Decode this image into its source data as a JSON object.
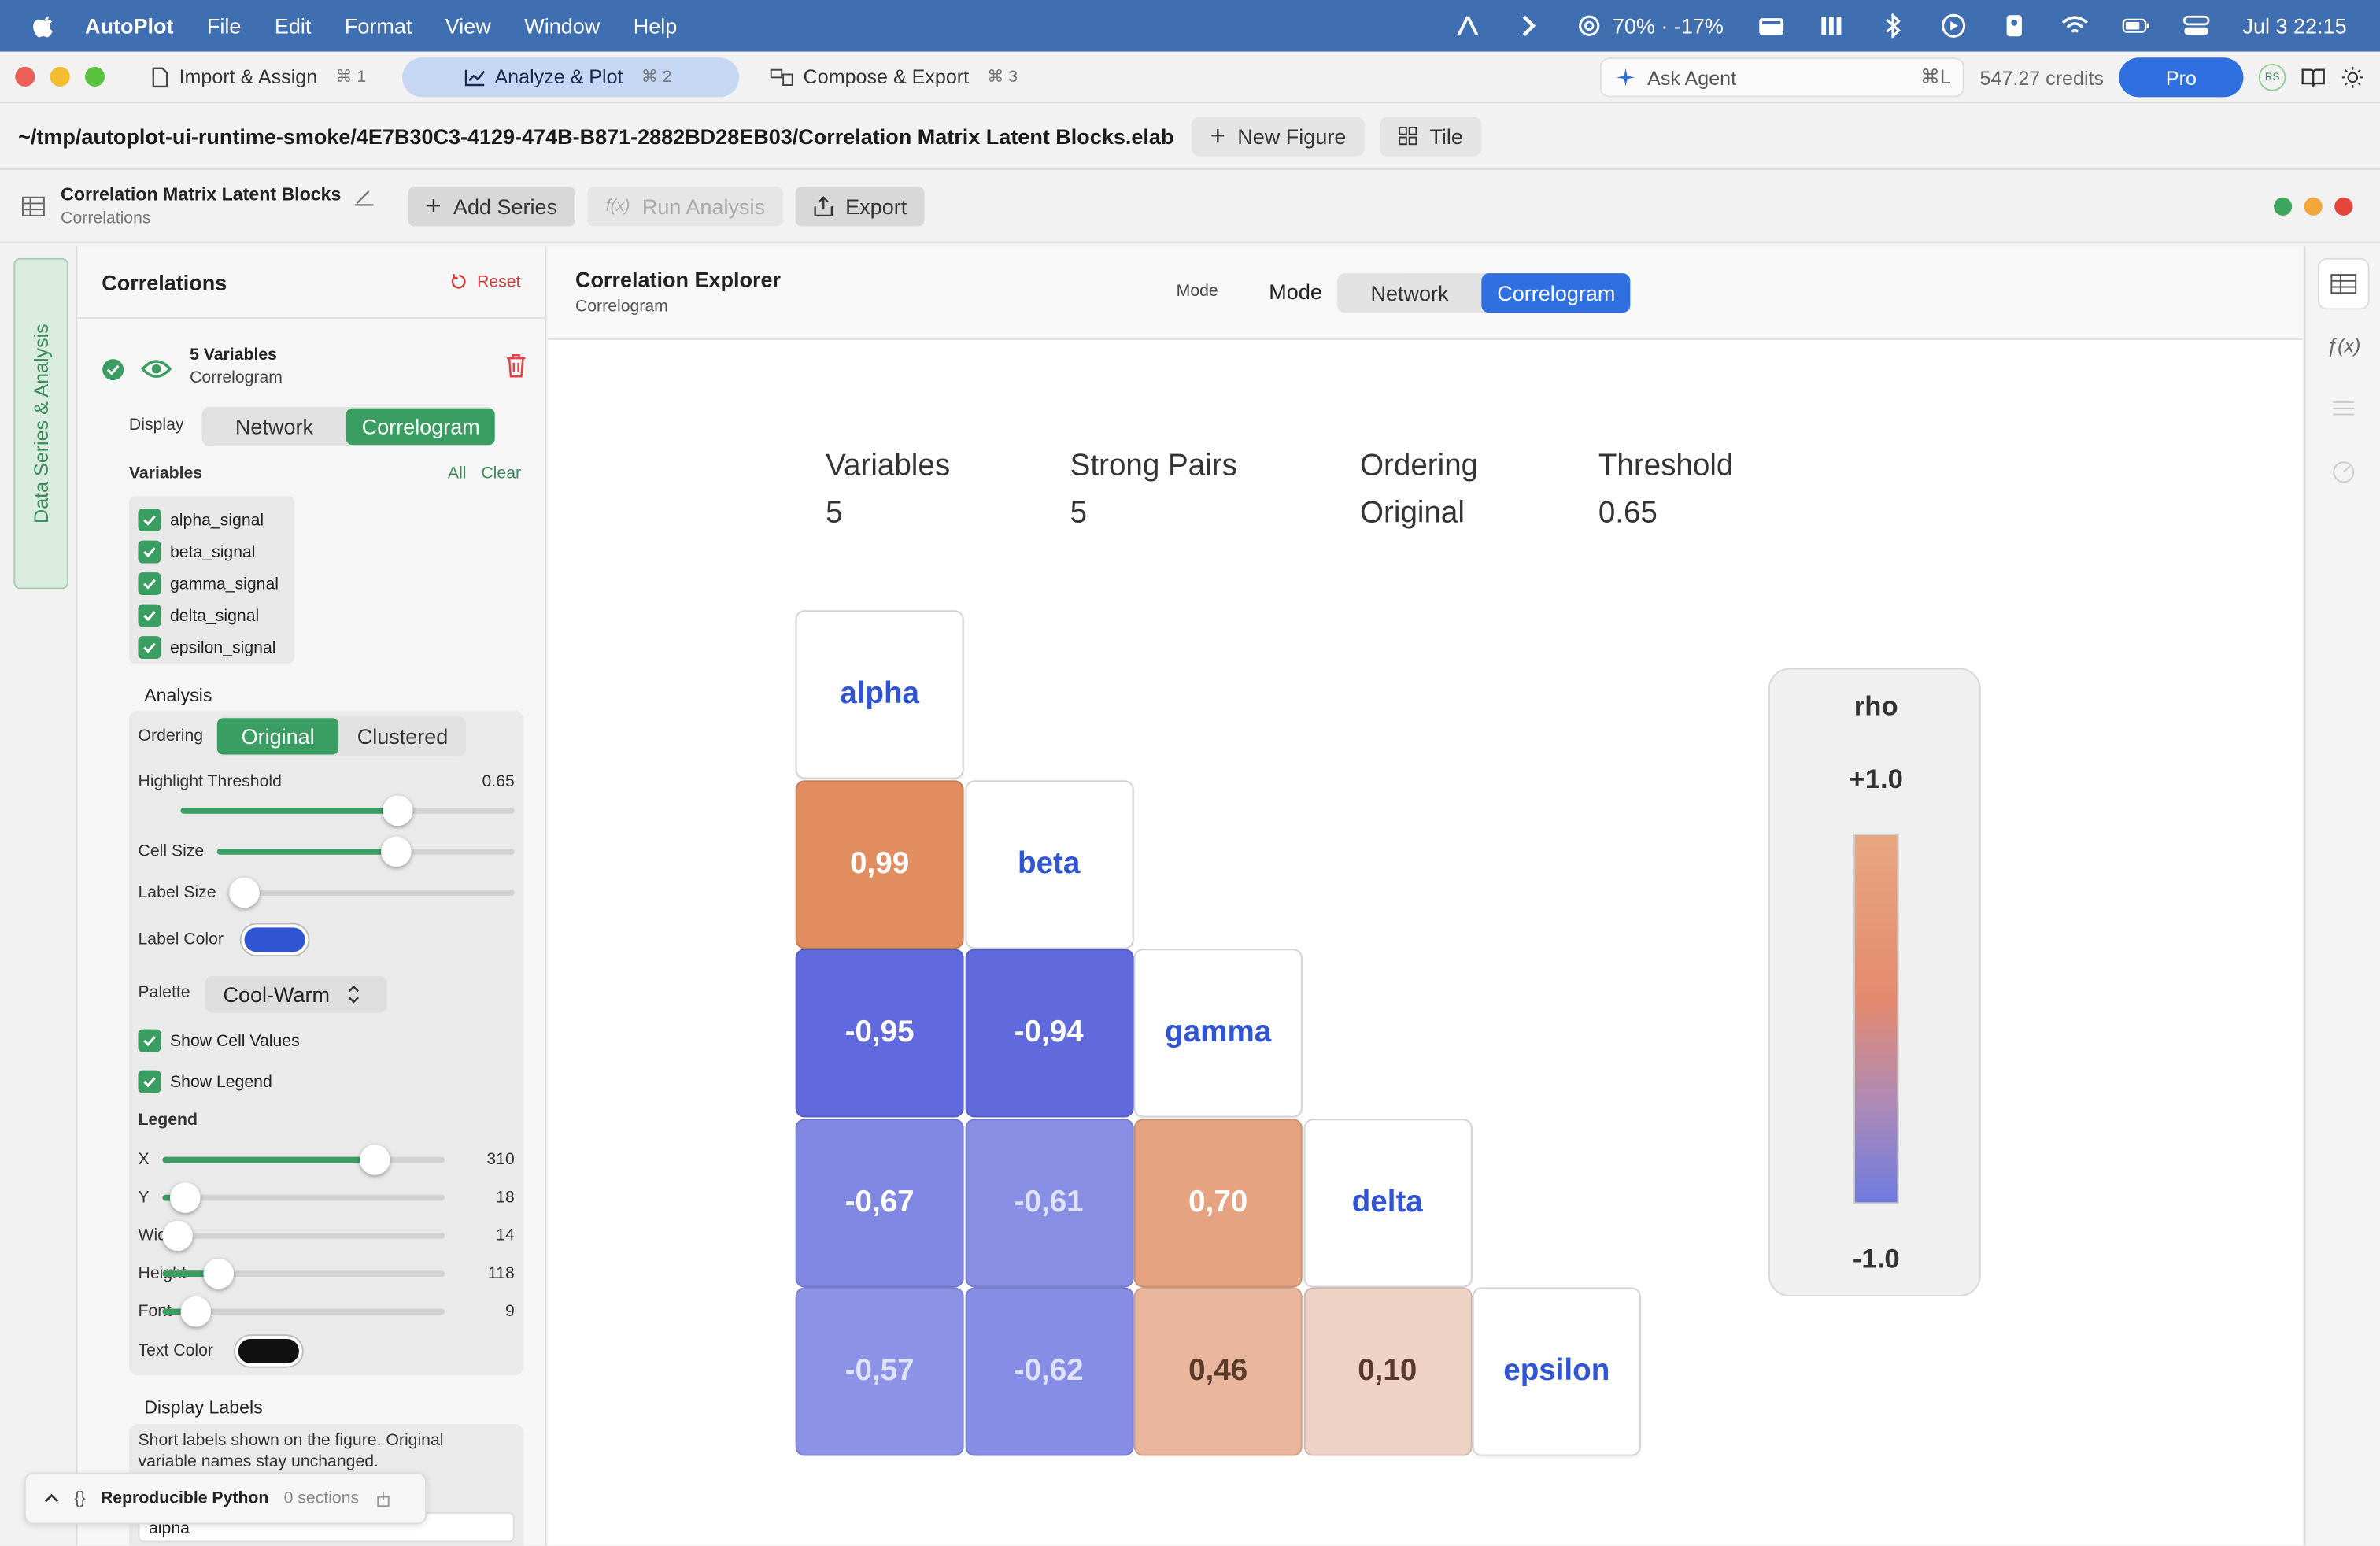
{
  "menubar": {
    "app_name": "AutoPlot",
    "menus": [
      "File",
      "Edit",
      "Format",
      "View",
      "Window",
      "Help"
    ],
    "battery_status": "70% · -17%",
    "datetime": "Jul 3  22:15"
  },
  "tabs": [
    {
      "label": "Import & Assign",
      "shortcut": "⌘ 1"
    },
    {
      "label": "Analyze & Plot",
      "shortcut": "⌘ 2"
    },
    {
      "label": "Compose & Export",
      "shortcut": "⌘ 3"
    }
  ],
  "topbar": {
    "ask_label": "Ask Agent",
    "ask_shortcut": "⌘L",
    "credits": "547.27 credits",
    "pro_label": "Pro",
    "avatar_initials": "RS"
  },
  "pathbar": {
    "path": "~/tmp/autoplot-ui-runtime-smoke/4E7B30C3-4129-474B-B871-2882BD28EB03/Correlation Matrix Latent Blocks.elab",
    "new_figure": "New Figure",
    "tile": "Tile"
  },
  "figure": {
    "title": "Correlation Matrix Latent Blocks",
    "subtitle": "Correlations",
    "add_series": "Add Series",
    "run_analysis_prefix": "f(x)",
    "run_analysis": "Run Analysis",
    "export": "Export"
  },
  "vertical_tab": "Data Series & Analysis",
  "panel": {
    "title": "Correlations",
    "reset": "Reset",
    "series_title": "5 Variables",
    "series_sub": "Correlogram",
    "display_label": "Display",
    "display_options": [
      "Network",
      "Correlogram"
    ],
    "variables_label": "Variables",
    "all": "All",
    "clear": "Clear",
    "variables": [
      "alpha_signal",
      "beta_signal",
      "gamma_signal",
      "delta_signal",
      "epsilon_signal"
    ],
    "analysis_label": "Analysis",
    "ordering_label": "Ordering",
    "ordering_options": [
      "Original",
      "Clustered"
    ],
    "highlight_label": "Highlight Threshold",
    "highlight_value": "0.65",
    "highlight_fraction": 0.65,
    "cell_size_label": "Cell Size",
    "cell_size_fraction": 0.6,
    "label_size_label": "Label Size",
    "label_size_fraction": 0.02,
    "label_color_label": "Label Color",
    "label_color": "#2f55d4",
    "palette_label": "Palette",
    "palette_value": "Cool-Warm",
    "show_values_label": "Show Cell Values",
    "show_legend_label": "Show Legend",
    "legend_label": "Legend",
    "legend_sliders": [
      {
        "label": "X",
        "value": "310",
        "fraction": 0.75
      },
      {
        "label": "Y",
        "value": "18",
        "fraction": 0.08
      },
      {
        "label": "Width",
        "value": "14",
        "fraction": 0.0
      },
      {
        "label": "Height",
        "value": "118",
        "fraction": 0.2
      },
      {
        "label": "Font",
        "value": "9",
        "fraction": 0.12
      }
    ],
    "text_color_label": "Text Color",
    "text_color": "#111111",
    "display_labels_title": "Display Labels",
    "display_labels_desc": "Short labels shown on the figure. Original variable names stay unchanged.",
    "first_label_value": "alpha"
  },
  "python_bar": {
    "label": "Reproducible Python",
    "sections": "0 sections"
  },
  "main": {
    "title": "Correlation Explorer",
    "subtitle": "Correlogram",
    "mode_small": "Mode",
    "mode_big": "Mode",
    "mode_options": [
      "Network",
      "Correlogram"
    ]
  },
  "chart_data": {
    "type": "heatmap",
    "stats": [
      {
        "label": "Variables",
        "value": "5"
      },
      {
        "label": "Strong Pairs",
        "value": "5"
      },
      {
        "label": "Ordering",
        "value": "Original"
      },
      {
        "label": "Threshold",
        "value": "0.65"
      }
    ],
    "variables": [
      "alpha",
      "beta",
      "gamma",
      "delta",
      "epsilon"
    ],
    "cells": [
      {
        "row": 1,
        "col": 0,
        "value": 0.99,
        "label": "0,99"
      },
      {
        "row": 2,
        "col": 0,
        "value": -0.95,
        "label": "-0,95"
      },
      {
        "row": 2,
        "col": 1,
        "value": -0.94,
        "label": "-0,94"
      },
      {
        "row": 3,
        "col": 0,
        "value": -0.67,
        "label": "-0,67"
      },
      {
        "row": 3,
        "col": 1,
        "value": -0.61,
        "label": "-0,61"
      },
      {
        "row": 3,
        "col": 2,
        "value": 0.7,
        "label": "0,70"
      },
      {
        "row": 4,
        "col": 0,
        "value": -0.57,
        "label": "-0,57"
      },
      {
        "row": 4,
        "col": 1,
        "value": -0.62,
        "label": "-0,62"
      },
      {
        "row": 4,
        "col": 2,
        "value": 0.46,
        "label": "0,46"
      },
      {
        "row": 4,
        "col": 3,
        "value": 0.1,
        "label": "0,10"
      }
    ],
    "legend": {
      "title": "rho",
      "max_label": "+1.0",
      "min_label": "-1.0",
      "placement": "right"
    },
    "threshold": 0.65,
    "palette": "Cool-Warm"
  }
}
